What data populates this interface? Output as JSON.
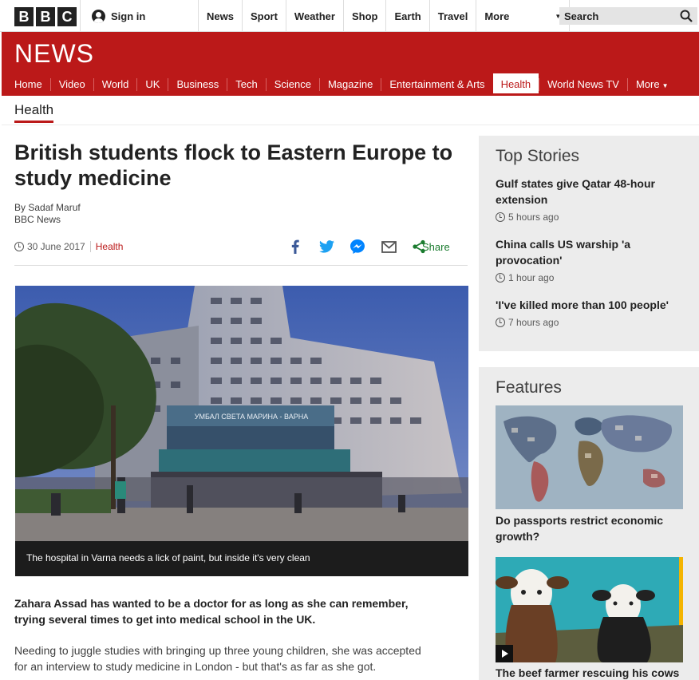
{
  "topbar": {
    "logo_letters": [
      "B",
      "B",
      "C"
    ],
    "signin_label": "Sign in",
    "nav": [
      "News",
      "Sport",
      "Weather",
      "Shop",
      "Earth",
      "Travel"
    ],
    "more_label": "More",
    "search_placeholder": "Search"
  },
  "banner": {
    "title": "NEWS",
    "nav": [
      "Home",
      "Video",
      "World",
      "UK",
      "Business",
      "Tech",
      "Science",
      "Magazine",
      "Entertainment & Arts",
      "Health",
      "World News TV"
    ],
    "active_item": "Health",
    "more_label": "More",
    "brand_color": "#bb1919"
  },
  "section": {
    "label": "Health"
  },
  "article": {
    "headline": "British students flock to Eastern Europe to study medicine",
    "author": "By Sadaf Maruf",
    "outlet": "BBC News",
    "date": "30 June 2017",
    "category": "Health",
    "share_label": "Share",
    "share_icons": [
      "facebook-icon",
      "twitter-icon",
      "messenger-icon",
      "email-icon",
      "share-icon"
    ],
    "hero_sign": "УМБАЛ СВЕТА МАРИНА - ВАРНА",
    "caption": "The hospital in Varna needs a lick of paint, but inside it's very clean",
    "lead": "Zahara Assad has wanted to be a doctor for as long as she can remember, trying several times to get into medical school in the UK.",
    "paragraph": "Needing to juggle studies with bringing up three young children, she was accepted for an interview to study medicine in London - but that's as far as she got."
  },
  "top_stories": {
    "heading": "Top Stories",
    "items": [
      {
        "title": "Gulf states give Qatar 48-hour extension",
        "ago": "5 hours ago"
      },
      {
        "title": "China calls US warship 'a provocation'",
        "ago": "1 hour ago"
      },
      {
        "title": "'I've killed more than 100 people'",
        "ago": "7 hours ago"
      }
    ]
  },
  "features": {
    "heading": "Features",
    "items": [
      {
        "title": "Do passports restrict economic growth?"
      },
      {
        "title": "The beef farmer rescuing his cows"
      }
    ]
  }
}
